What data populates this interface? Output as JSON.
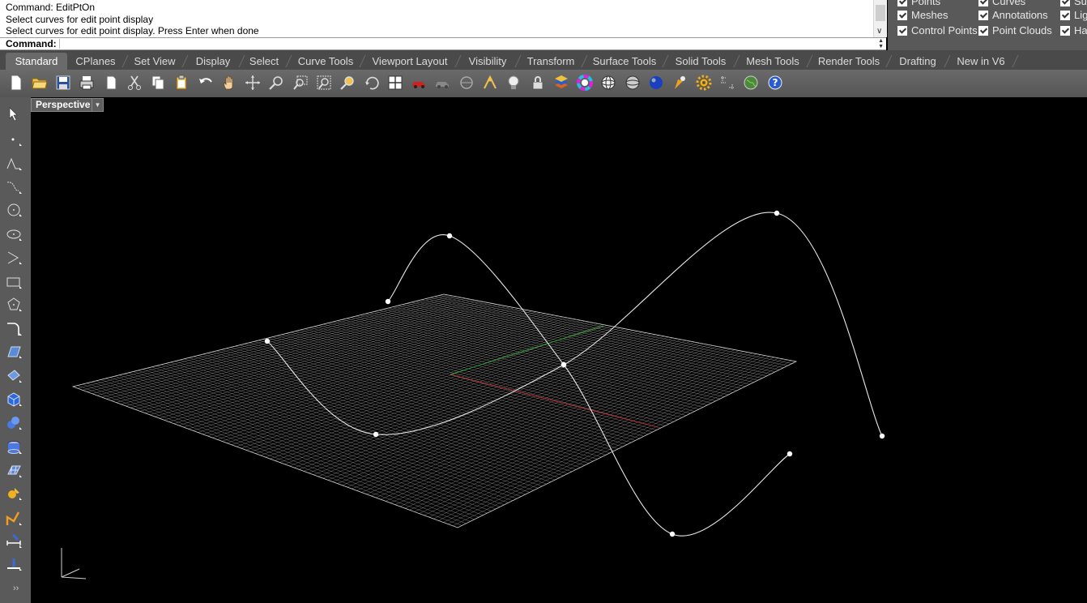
{
  "command_history": {
    "lines": [
      "Command: EditPtOn",
      "Select curves for edit point display",
      "Select curves for edit point display. Press Enter when done"
    ]
  },
  "command_line": {
    "label": "Command:",
    "value": ""
  },
  "object_filters": [
    {
      "label": "Points",
      "checked": true
    },
    {
      "label": "Curves",
      "checked": true
    },
    {
      "label": "Su",
      "checked": true
    },
    {
      "label": "Meshes",
      "checked": true
    },
    {
      "label": "Annotations",
      "checked": true
    },
    {
      "label": "Lig",
      "checked": true
    },
    {
      "label": "Control Points",
      "checked": true
    },
    {
      "label": "Point Clouds",
      "checked": true
    },
    {
      "label": "Hat",
      "checked": true
    }
  ],
  "tabs": [
    "Standard",
    "CPlanes",
    "Set View",
    "Display",
    "Select",
    "Curve Tools",
    "Viewport Layout",
    "Visibility",
    "Transform",
    "Surface Tools",
    "Solid Tools",
    "Mesh Tools",
    "Render Tools",
    "Drafting",
    "New in V6"
  ],
  "active_tab": "Standard",
  "toolbar_icons": [
    "new-file-icon",
    "open-folder-icon",
    "save-icon",
    "print-icon",
    "import-icon",
    "cut-icon",
    "copy-icon",
    "paste-icon",
    "undo-icon",
    "pan-hand-icon",
    "rotate-view-icon",
    "zoom-icon",
    "zoom-window-icon",
    "zoom-extents-icon",
    "zoom-selected-icon",
    "rotate-camera-icon",
    "four-viewports-icon",
    "car-icon",
    "hide-icon",
    "show-icon",
    "snap-icon",
    "light-bulb-icon",
    "lock-icon",
    "layer-icon",
    "color-wheel-icon",
    "wireframe-sphere-icon",
    "shaded-sphere-icon",
    "rendered-sphere-icon",
    "material-icon",
    "options-gear-icon",
    "grid-icon",
    "globe-icon",
    "help-icon"
  ],
  "left_toolbar_icons": [
    "select-arrow-icon",
    "point-icon",
    "polyline-icon",
    "curve-icon",
    "circle-icon",
    "ellipse-icon",
    "arc-polygon-icon",
    "rectangle-icon",
    "polygon-icon",
    "fillet-icon",
    "surface-icon",
    "extrude-icon",
    "box-solid-icon",
    "boolean-icon",
    "cylinder-icon",
    "mesh-icon",
    "transform-icon",
    "analyze-icon",
    "dimension-icon",
    "drafting-icon"
  ],
  "viewport": {
    "title": "Perspective"
  },
  "colors": {
    "viewport_bg": "#000000",
    "curve": "#e6e6e6",
    "grid": "#b0b0b0",
    "x_axis": "#b03030",
    "y_axis": "#30a030"
  }
}
